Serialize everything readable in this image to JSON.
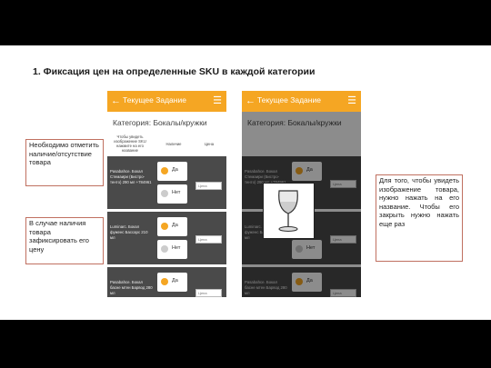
{
  "title": "1. Фиксация цен на определенные SKU в каждой категории",
  "app": {
    "header": "Текущее Задание",
    "category": "Категория: Бокалы/кружки",
    "col_image": "Чтобы увидеть изображение SKU нажмите на его название",
    "col_presence": "Наличие",
    "col_price": "Цена",
    "yes_label": "Да",
    "no_label": "Нет",
    "price_placeholder": "Цена"
  },
  "products_left": [
    {
      "name": "Pasabahce. Бокал Стемаири (Бистро-тенто) 290 мл +784961"
    },
    {
      "name": "Luminarc. Бокал фуженс Бассарс 210 мл"
    },
    {
      "name": "Pasabahce. Бокал басне мтен Барвод 280 мл"
    }
  ],
  "products_right": [
    {
      "name": "Pasabahce. Бокал Стемаири (Бистро-тенто) 290 мл +784961"
    },
    {
      "name": "Luminarc. Бокал фуженс Бассарс 210 мл"
    },
    {
      "name": "Pasabahce. Бокал басне мтен Барвод 280 мл"
    }
  ],
  "callouts": {
    "need_mark": "Необходимо отметить наличие/отсутствие товара",
    "if_present": "В случае наличия товара зафиксировать его цену",
    "to_view": "Для того, чтобы увидеть изображение товара, нужно нажать на его название. Чтобы его закрыть нужно нажать еще раз"
  },
  "colors": {
    "accent": "#f5a623",
    "row_bg": "#4a4a4a",
    "callout_border": "#c07060"
  }
}
